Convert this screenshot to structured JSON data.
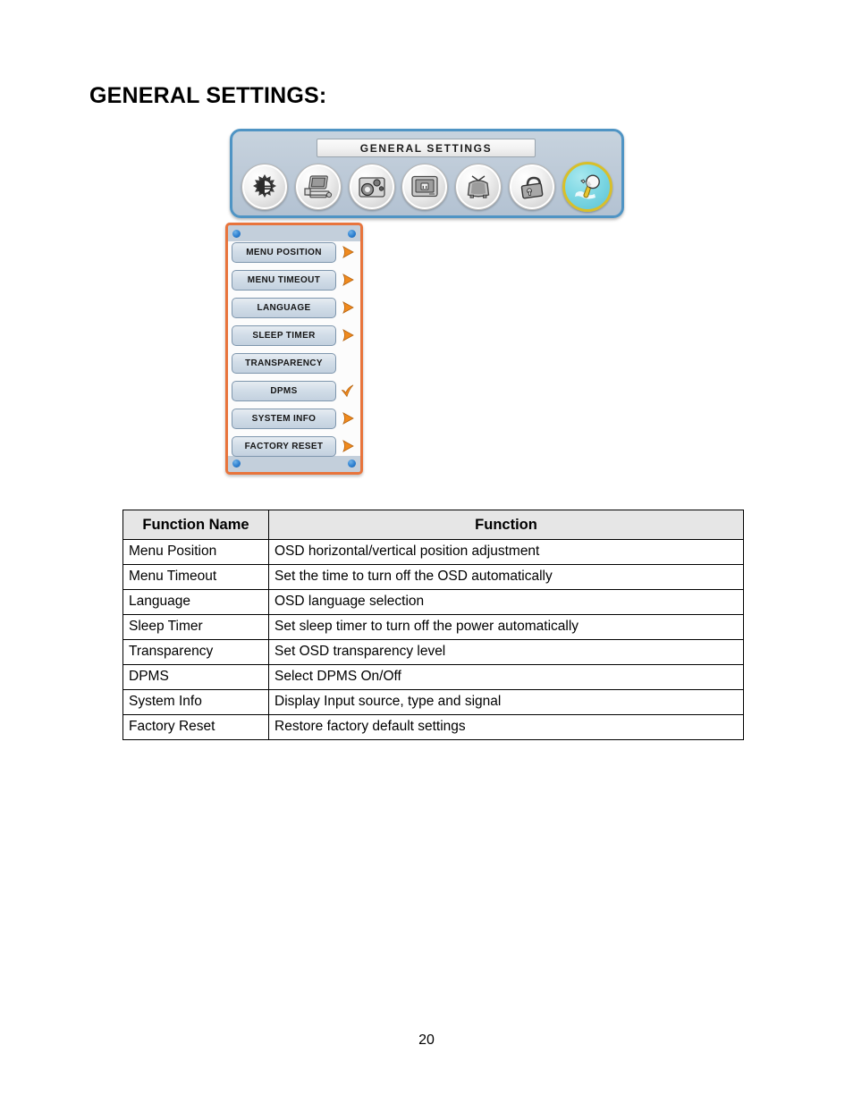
{
  "page": {
    "heading": "GENERAL SETTINGS:",
    "number": "20"
  },
  "osd": {
    "title": "GENERAL SETTINGS",
    "accent_border": "#4f94c4",
    "panel_fill": "#bcc9d7",
    "submenu_border": "#e8743c",
    "selected_ring": "#d8bf2a",
    "selected_fill": "#5cc3d4",
    "icons": [
      {
        "name": "brightness-contrast-icon",
        "label": "Brightness / Contrast",
        "selected": false
      },
      {
        "name": "image-setup-icon",
        "label": "Image Setup",
        "selected": false
      },
      {
        "name": "color-settings-icon",
        "label": "Color Settings",
        "selected": false
      },
      {
        "name": "input-source-icon",
        "label": "Input Source",
        "selected": false
      },
      {
        "name": "picture-mode-icon",
        "label": "Picture Mode",
        "selected": false
      },
      {
        "name": "osd-lock-icon",
        "label": "OSD Lock",
        "selected": false
      },
      {
        "name": "general-settings-icon",
        "label": "General Settings",
        "selected": true
      }
    ],
    "submenu": [
      {
        "label": "MENU POSITION",
        "marker": "arrow"
      },
      {
        "label": "MENU TIMEOUT",
        "marker": "arrow"
      },
      {
        "label": "LANGUAGE",
        "marker": "arrow"
      },
      {
        "label": "SLEEP TIMER",
        "marker": "arrow"
      },
      {
        "label": "TRANSPARENCY",
        "marker": "none"
      },
      {
        "label": "DPMS",
        "marker": "check"
      },
      {
        "label": "SYSTEM INFO",
        "marker": "arrow"
      },
      {
        "label": "FACTORY RESET",
        "marker": "arrow"
      }
    ]
  },
  "table": {
    "headers": [
      "Function Name",
      "Function"
    ],
    "rows": [
      [
        "Menu Position",
        "OSD horizontal/vertical position adjustment"
      ],
      [
        "Menu Timeout",
        "Set the time to turn off the OSD automatically"
      ],
      [
        "Language",
        "OSD language selection"
      ],
      [
        "Sleep Timer",
        "Set sleep timer to turn off the power automatically"
      ],
      [
        "Transparency",
        "Set OSD transparency level"
      ],
      [
        "DPMS",
        "Select DPMS On/Off"
      ],
      [
        "System Info",
        "Display Input source, type and signal"
      ],
      [
        "Factory Reset",
        "Restore factory default settings"
      ]
    ]
  }
}
